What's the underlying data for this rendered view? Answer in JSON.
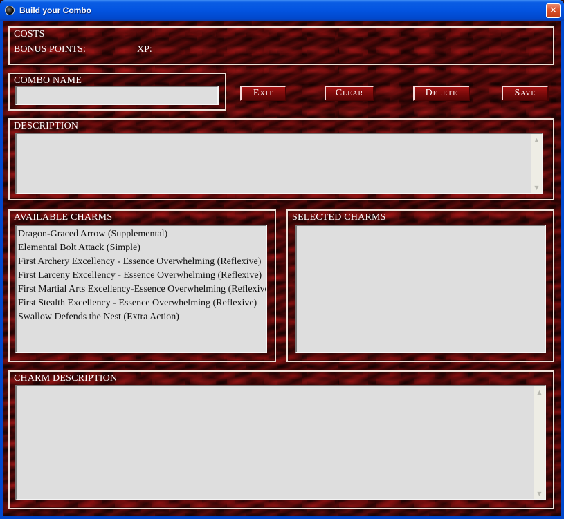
{
  "window": {
    "title": "Build your Combo",
    "close_glyph": "✕"
  },
  "costs": {
    "title": "COSTS",
    "bonus_points_label": "BONUS POINTS:",
    "xp_label": "XP:"
  },
  "combo_name": {
    "title": "COMBO NAME",
    "value": ""
  },
  "buttons": {
    "exit": "Exit",
    "clear": "Clear",
    "delete": "Delete",
    "save": "Save"
  },
  "description": {
    "title": "DESCRIPTION",
    "value": ""
  },
  "available_charms": {
    "title": "AVAILABLE CHARMS",
    "items": [
      "Dragon-Graced Arrow (Supplemental)",
      "Elemental Bolt Attack (Simple)",
      "First Archery Excellency - Essence Overwhelming (Reflexive)",
      "First Larceny Excellency - Essence Overwhelming (Reflexive)",
      "First Martial Arts Excellency-Essence Overwhelming (Reflexive)",
      "First Stealth Excellency - Essence Overwhelming (Reflexive)",
      "Swallow Defends the Nest (Extra Action)"
    ]
  },
  "selected_charms": {
    "title": "SELECTED CHARMS",
    "items": []
  },
  "charm_description": {
    "title": "CHARM DESCRIPTION",
    "value": ""
  },
  "icons": {
    "app": "app-icon",
    "close": "close-icon",
    "scroll_up": "scroll-up-arrow-icon",
    "scroll_down": "scroll-down-arrow-icon"
  }
}
